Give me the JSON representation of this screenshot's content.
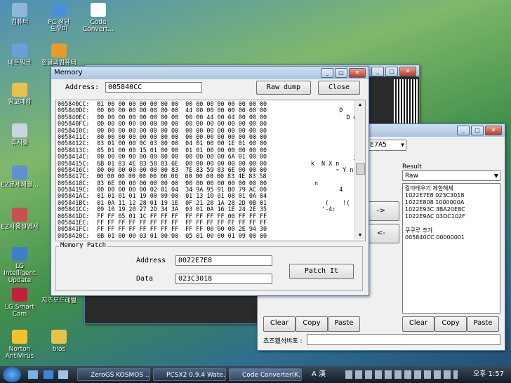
{
  "desktop": {
    "icons": [
      {
        "label": "컴퓨터",
        "color": "#8fb7d9"
      },
      {
        "label": "PC 상담\n도우미",
        "color": "#4a90d9"
      },
      {
        "label": "Code\nConvert...",
        "color": "#ffffff"
      },
      {
        "label": "네트워크",
        "color": "#6aa0d8"
      },
      {
        "label": "한글과컴퓨터",
        "color": "#e89a2d"
      },
      {
        "label": "왕고예감",
        "color": "#e7c24a"
      },
      {
        "label": "휴지통",
        "color": "#c8d6e2"
      },
      {
        "label": "EZ문제해결...",
        "color": "#5f8fd1"
      },
      {
        "label": "EZ사용설명서",
        "color": "#c95050"
      },
      {
        "label": "LG Intelligent\nUpdate",
        "color": "#3f7fca"
      },
      {
        "label": "LG Smart\nCam",
        "color": "#c0213c"
      },
      {
        "label": "Norton\nAntiVirus",
        "color": "#f2c230"
      },
      {
        "label": "bios",
        "color": "#e7c24a"
      },
      {
        "label": "지즈모드레벨",
        "color": "#4aa0e0"
      }
    ]
  },
  "memory_window": {
    "title": "Memory",
    "address_label": "Address:",
    "address_value": "005840CC",
    "raw_dump_label": "Raw dump",
    "close_label": "Close",
    "hex_rows": [
      {
        "addr": "005840CC:",
        "hex": "01 00 00 00 00 00 00 00  00 00 00 00 00 00 00 00",
        "ascii": ""
      },
      {
        "addr": "005840DC:",
        "hex": "00 00 00 00 00 00 00 00  44 00 00 00 00 00 00 00",
        "ascii": "        D"
      },
      {
        "addr": "005840EC:",
        "hex": "00 00 00 00 00 00 00 00  00 00 44 00 64 00 00 00",
        "ascii": "          D d"
      },
      {
        "addr": "005840FC:",
        "hex": "00 00 00 00 00 00 00 00  00 00 00 00 00 00 00 00",
        "ascii": ""
      },
      {
        "addr": "0058410C:",
        "hex": "00 00 00 00 00 00 00 00  00 00 00 00 00 00 00 00",
        "ascii": ""
      },
      {
        "addr": "0058411C:",
        "hex": "00 00 00 00 00 00 00 00  00 00 00 00 00 00 00 00",
        "ascii": ""
      },
      {
        "addr": "0058412C:",
        "hex": "03 01 00 00 0C 03 00 00  04 01 00 00 1E 01 00 00",
        "ascii": ""
      },
      {
        "addr": "0058413C:",
        "hex": "05 01 00 00 15 01 00 00  01 01 00 00 00 00 00 00",
        "ascii": ""
      },
      {
        "addr": "0058414C:",
        "hex": "00 00 00 00 00 00 00 00  00 00 00 00 6A 01 00 00",
        "ascii": "            j"
      },
      {
        "addr": "0058415C:",
        "hex": "6B 01 83 4E 83 58 83 6E  00 00 00 00 00 00 00 00",
        "ascii": "k  N X n"
      },
      {
        "addr": "0058416C:",
        "hex": "00 00 00 00 00 00 00 83  7E 83 59 83 6E 00 00 00",
        "ascii": "       ~ Y n"
      },
      {
        "addr": "0058417C:",
        "hex": "00 00 00 00 00 00 00 00  00 00 00 00 83 4E 83 58",
        "ascii": "             N X"
      },
      {
        "addr": "0058418C:",
        "hex": "83 6E 00 00 00 00 00 00  00 00 00 00 00 00 00 00",
        "ascii": " n"
      },
      {
        "addr": "0058419C:",
        "hex": "00 00 00 00 00 02 01 04  34 9A 95 91 B0 79 AC 00",
        "ascii": "        4    y"
      },
      {
        "addr": "005841AC:",
        "hex": "01 01 01 01 19 00 09 00  01 13 10 01 08 01 0A 04",
        "ascii": ""
      },
      {
        "addr": "005841BC:",
        "hex": "01 0A 11 12 28 01 19 1E  0F 21 28 1A 28 2D 0B 01",
        "ascii": "    (    !( ( -"
      },
      {
        "addr": "005841CC:",
        "hex": "09 10 19 20 27 2D 34 3A  03 01 0A 16 1E 24 2E 35",
        "ascii": "   '-4:"
      },
      {
        "addr": "005841DC:",
        "hex": "FF FF 05 01 1C FF FF FF  FF FF FF FF 00 FF FF FF",
        "ascii": ""
      },
      {
        "addr": "005841EC:",
        "hex": "FF FF FF FF FF FF FF FF  FF FF FF FF FF FF FF FF",
        "ascii": ""
      },
      {
        "addr": "005841FC:",
        "hex": "FF FF FF FF FF FF FF FF  FF FF 00 00 00 2E 94 30",
        "ascii": ""
      },
      {
        "addr": "0058420C:",
        "hex": "0B 01 00 00 03 01 00 00  05 01 00 00 01 09 00 00",
        "ascii": ""
      }
    ],
    "patch_group_label": "Memory Patch",
    "patch_address_label": "Address",
    "patch_address_value": "0022E7E8",
    "patch_data_label": "Data",
    "patch_data_value": "023C3018",
    "patch_button_label": "Patch It"
  },
  "converter_window": {
    "code_field_value": "E7A5",
    "result_label": "Result",
    "result_select_value": "Raw",
    "result_lines": [
      "갈아테우기 제한해제",
      "1022E7E8 023C3018",
      "1022E808 1000000A",
      "1022E93C 3BA20E8C",
      "1022E9AC 03DC102F",
      "",
      "쿠쿠루 추가",
      "005840CC 00000001"
    ],
    "arrow_right_label": "->",
    "arrow_left_label": "<-",
    "left_buttons": [
      "Clear",
      "Copy",
      "Paste"
    ],
    "right_buttons": [
      "Clear",
      "Copy",
      "Paste"
    ],
    "status_label": "쵸즈횄석뱌포 :"
  },
  "taskbar": {
    "items": [
      "ZeroGS KOSMOS ...",
      "PCSX2 0.9.4 Wate...",
      "Code Converter(K..."
    ],
    "tray_text": "A 漢",
    "clock": "오후 1:57"
  }
}
